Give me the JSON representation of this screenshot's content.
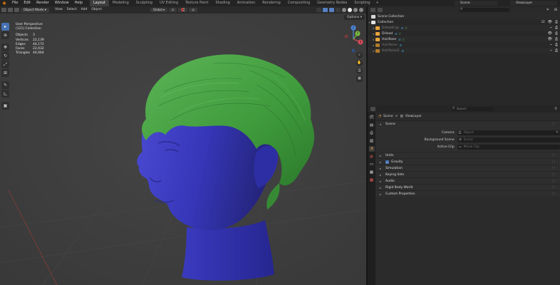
{
  "top_menu": {
    "items": [
      "File",
      "Edit",
      "Render",
      "Window",
      "Help"
    ],
    "workspaces": [
      "Layout",
      "Modeling",
      "Sculpting",
      "UV Editing",
      "Texture Paint",
      "Shading",
      "Animation",
      "Rendering",
      "Compositing",
      "Geometry Nodes",
      "Scripting"
    ],
    "active_workspace": "Layout",
    "add_workspace": "+",
    "scene": "Scene",
    "view_layer": "ViewLayer"
  },
  "viewport_header": {
    "mode": "Object Mode",
    "menus": [
      "View",
      "Select",
      "Add",
      "Object"
    ],
    "transform_orientation": "Global",
    "options_label": "Options"
  },
  "viewport_stats": {
    "perspective": "User Perspective",
    "collection": "(121) Collection",
    "rows": [
      {
        "label": "Objects",
        "value": "3"
      },
      {
        "label": "Vertices",
        "value": "22,139"
      },
      {
        "label": "Edges",
        "value": "44,172"
      },
      {
        "label": "Faces",
        "value": "22,032"
      },
      {
        "label": "Triangles",
        "value": "44,064"
      }
    ]
  },
  "gizmo_axes": {
    "x": "X",
    "y": "Y",
    "z": "Z"
  },
  "outliner": {
    "search_placeholder": "",
    "rows": [
      {
        "name": "Scene Collection",
        "dim": false
      },
      {
        "name": "Collection",
        "dim": false
      },
      {
        "name": "DHeadCap",
        "dim": true
      },
      {
        "name": "DHead",
        "dim": false
      },
      {
        "name": "HairBase",
        "dim": false
      },
      {
        "name": "HairNoise",
        "dim": true
      },
      {
        "name": "HairNoise2",
        "dim": true
      }
    ]
  },
  "properties": {
    "search_placeholder": "Search",
    "breadcrumb": {
      "scene": "Scene",
      "separator": ">",
      "layer": "ViewLayer"
    },
    "scene_panel": {
      "title": "Scene",
      "fields": [
        {
          "label": "Camera",
          "placeholder": "Object"
        },
        {
          "label": "Background Scene",
          "placeholder": "Scene"
        },
        {
          "label": "Active Clip",
          "placeholder": "Movie Clip"
        }
      ]
    },
    "panels": [
      {
        "title": "Units",
        "checkbox": false
      },
      {
        "title": "Gravity",
        "checkbox": true
      },
      {
        "title": "Simulation",
        "checkbox": false
      },
      {
        "title": "Keying Sets",
        "checkbox": false
      },
      {
        "title": "Audio",
        "checkbox": false
      },
      {
        "title": "Rigid Body World",
        "checkbox": false
      },
      {
        "title": "Custom Properties",
        "checkbox": false
      }
    ]
  },
  "colors": {
    "accent": "#4772b3",
    "head": "#3b3ab8",
    "hair": "#3f9a3c",
    "axis_x": "#e04c5c",
    "axis_y": "#7dbb3f",
    "axis_z": "#4e8ae0"
  }
}
